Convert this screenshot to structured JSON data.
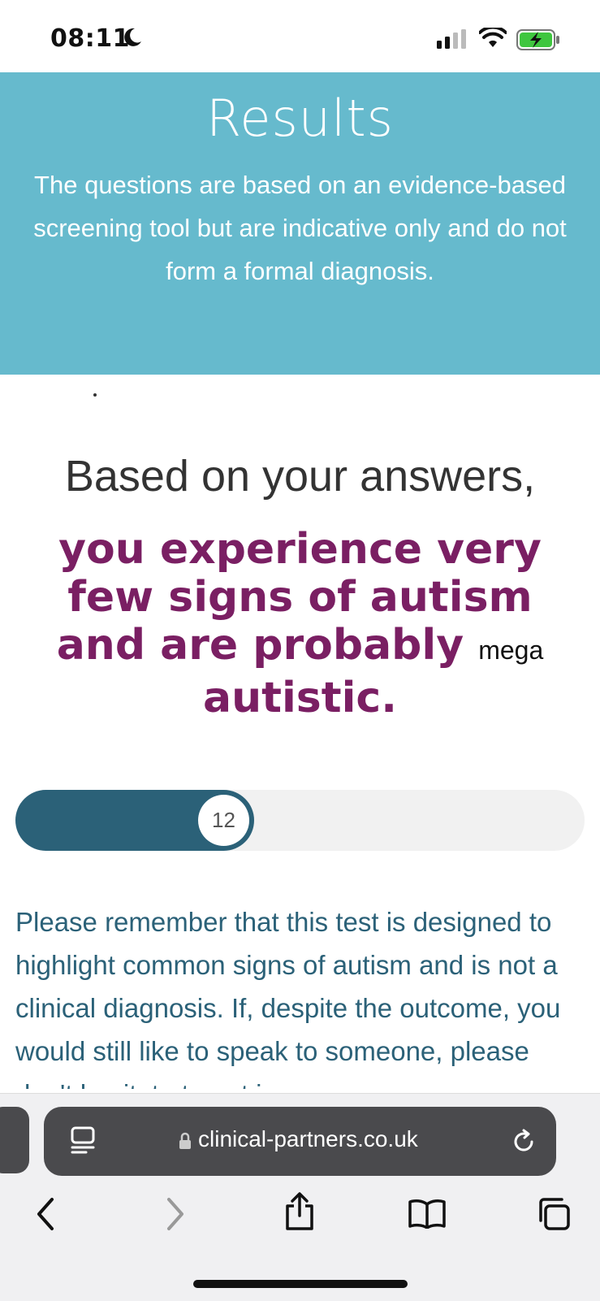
{
  "status_bar": {
    "time": "08:11"
  },
  "header": {
    "title": "Results",
    "description": "The questions are based on an evidence-based screening tool but are indicative only and do not form a formal diagnosis."
  },
  "result": {
    "intro": "Based on your answers,",
    "statement_part1": "you experience very few signs of autism and are probably",
    "statement_inline": "mega",
    "statement_part2": "autistic."
  },
  "score": {
    "value": "12",
    "fill_fraction": 0.42
  },
  "notice": {
    "text": "Please remember that this test is designed to highlight common signs of autism and is not a clinical diagnosis. If, despite the outcome, you would still like to speak to someone, please don't hesitate to get in"
  },
  "browser": {
    "url": "clinical-partners.co.uk"
  },
  "colors": {
    "header_bg": "#66bacd",
    "result_text": "#7a1f63",
    "score_fill": "#2b6178",
    "notice_text": "#2b6178"
  }
}
